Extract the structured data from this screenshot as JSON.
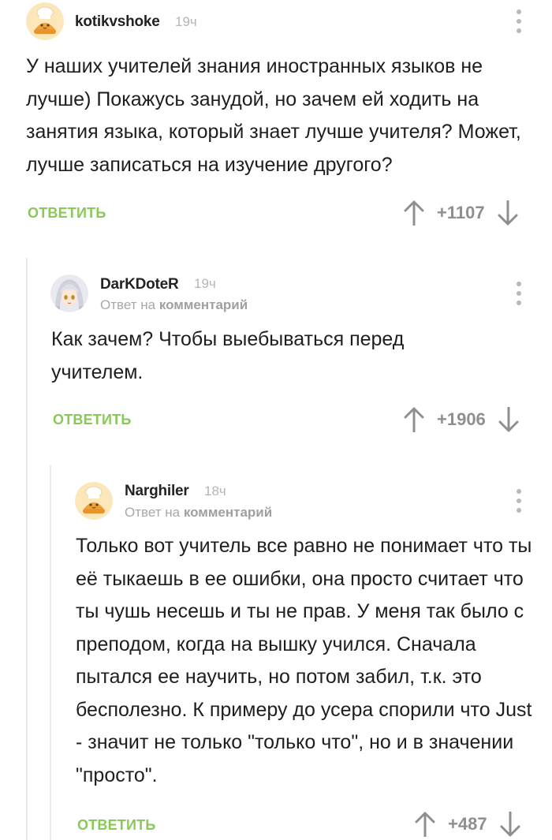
{
  "comments": [
    {
      "username": "kotikvshoke",
      "time": "19ч",
      "reply_prefix": "",
      "reply_link": "",
      "text": "У наших учителей знания иностранных языков не лучше) Покажусь занудой, но зачем ей ходить на занятия языка, который знает лучше учителя? Может, лучше записаться на изучение другого?",
      "reply_label": "ОТВЕТИТЬ",
      "score": "+1107",
      "avatar_icon": "bun-chef-icon"
    },
    {
      "username": "DarKDoteR",
      "time": "19ч",
      "reply_prefix": "Ответ на",
      "reply_link": "комментарий",
      "text": "Как зачем? Чтобы выебываться перед учителем.",
      "reply_label": "ОТВЕТИТЬ",
      "score": "+1906",
      "avatar_icon": "anime-girl-icon"
    },
    {
      "username": "Narghiler",
      "time": "18ч",
      "reply_prefix": "Ответ на",
      "reply_link": "комментарий",
      "text": "Только вот учитель все равно не понимает что ты её тыкаешь в ее ошибки, она просто считает что ты чушь несешь и ты не прав. У меня так было с преподом, когда на вышку учился. Сначала пытался ее научить, но потом забил, т.к. это бесполезно. К примеру до усера спорили что Just - значит не только \"только что\", но и в значении \"просто\".",
      "reply_label": "ОТВЕТИТЬ",
      "score": "+487",
      "avatar_icon": "bun-chef-icon"
    }
  ],
  "colors": {
    "reply_green": "#8ac858",
    "muted_gray": "#b5b5b5",
    "thread_line": "#eaeaea"
  }
}
